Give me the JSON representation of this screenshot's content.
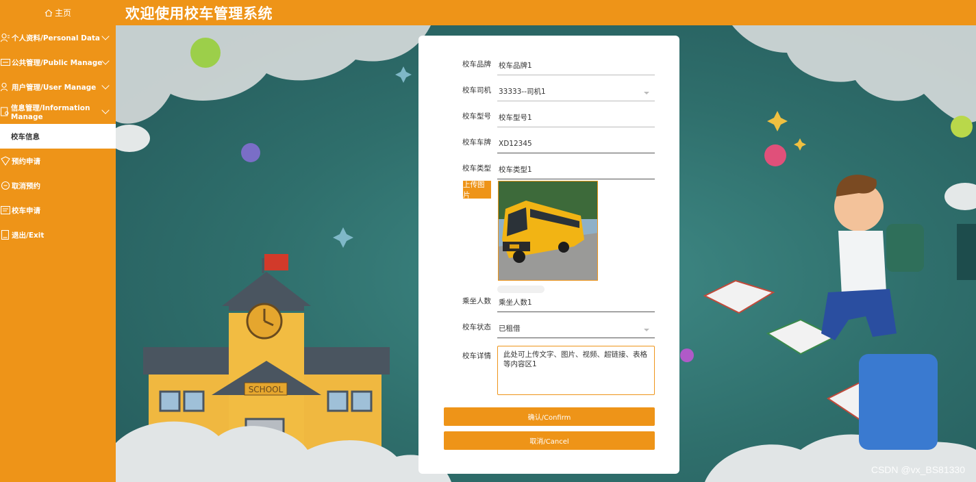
{
  "header": {
    "home_label": "主页",
    "title": "欢迎使用校车管理系统"
  },
  "sidebar": {
    "items": [
      {
        "label": "个人资料/Personal Data",
        "icon": "user-icon",
        "expandable": true
      },
      {
        "label": "公共管理/Public Manage",
        "icon": "public-icon",
        "expandable": true
      },
      {
        "label": "用户管理/User Manage",
        "icon": "users-icon",
        "expandable": true
      },
      {
        "label": "信息管理/Information Manage",
        "icon": "info-icon",
        "expandable": true
      },
      {
        "label": "校车信息",
        "icon": "",
        "expandable": false,
        "active": true
      },
      {
        "label": "预约申请",
        "icon": "booking-icon",
        "expandable": false
      },
      {
        "label": "取消预约",
        "icon": "cancel-booking-icon",
        "expandable": false
      },
      {
        "label": "校车申请",
        "icon": "bus-apply-icon",
        "expandable": false
      },
      {
        "label": "退出/Exit",
        "icon": "exit-icon",
        "expandable": false
      }
    ]
  },
  "form": {
    "brand": {
      "label": "校车品牌",
      "value": "校车品牌1"
    },
    "driver": {
      "label": "校车司机",
      "value": "33333--司机1"
    },
    "model": {
      "label": "校车型号",
      "value": "校车型号1"
    },
    "plate": {
      "label": "校车车牌",
      "value": "XD12345"
    },
    "type": {
      "label": "校车类型",
      "value": "校车类型1"
    },
    "upload_label": "上传图片",
    "seats": {
      "label": "乘坐人数",
      "value": "乘坐人数1"
    },
    "status": {
      "label": "校车状态",
      "value": "已租借"
    },
    "detail": {
      "label": "校车详情",
      "value": "此处可上传文字、图片、视频、超链接、表格等内容区1"
    },
    "confirm_label": "确认/Confirm",
    "cancel_label": "取消/Cancel"
  },
  "watermark": "CSDN @vx_BS81330",
  "colors": {
    "accent": "#ee9418",
    "scene": "#2f6f6c"
  }
}
